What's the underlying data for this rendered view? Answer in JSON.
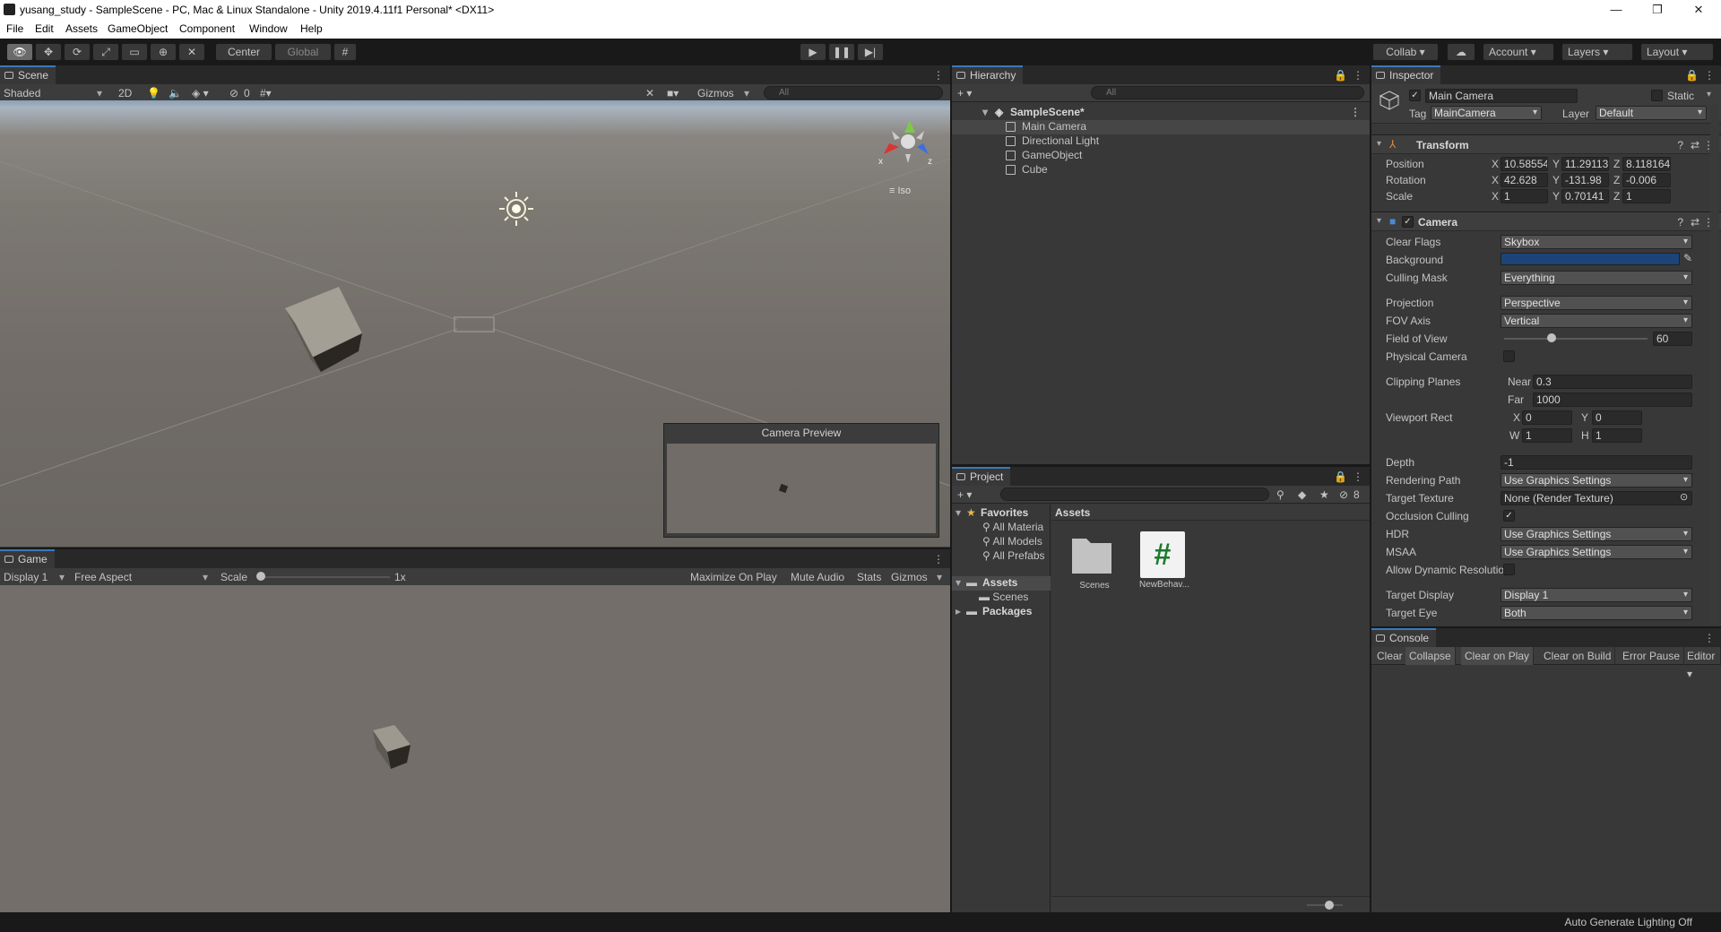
{
  "window": {
    "title": "yusang_study - SampleScene - PC, Mac & Linux Standalone - Unity 2019.4.11f1 Personal* <DX11>",
    "controls": [
      "—",
      "❐",
      "✕"
    ]
  },
  "menu": [
    "File",
    "Edit",
    "Assets",
    "GameObject",
    "Component",
    "Window",
    "Help"
  ],
  "toolbar": {
    "pivot_label": "Center",
    "space_label": "Global",
    "collab_label": "Collab ▾",
    "account_label": "Account",
    "layers_label": "Layers",
    "layout_label": "Layout"
  },
  "scene": {
    "tab_label": "Scene",
    "shading_mode": "Shaded",
    "mode_2d": "2D",
    "hidden_count": "0",
    "gizmos_label": "Gizmos",
    "search_placeholder": "All",
    "projection_label": "≡ Iso",
    "camera_preview_title": "Camera Preview",
    "axis_x": "x",
    "axis_z": "z"
  },
  "game": {
    "tab_label": "Game",
    "display": "Display 1",
    "aspect": "Free Aspect",
    "scale_label": "Scale",
    "scale_value": "1x",
    "scale_level": 0.0,
    "maximize_label": "Maximize On Play",
    "mute_label": "Mute Audio",
    "stats_label": "Stats",
    "gizmos_label": "Gizmos"
  },
  "hierarchy": {
    "tab_label": "Hierarchy",
    "search_placeholder": "All",
    "scene_name": "SampleScene*",
    "items": [
      "Main Camera",
      "Directional Light",
      "GameObject",
      "Cube"
    ]
  },
  "project": {
    "tab_label": "Project",
    "hidden_count": "8",
    "favorites_label": "Favorites",
    "favorites": [
      "All Materia",
      "All Models",
      "All Prefabs"
    ],
    "assets_label": "Assets",
    "asset_folders": [
      "Scenes"
    ],
    "packages_label": "Packages",
    "breadcrumb": "Assets",
    "grid_items": [
      {
        "name": "Scenes",
        "icon": "folder-icon"
      },
      {
        "name": "NewBehav...",
        "icon": "csharp-script-icon"
      }
    ]
  },
  "inspector": {
    "tab_label": "Inspector",
    "object_name": "Main Camera",
    "static_label": "Static",
    "tag_label": "Tag",
    "tag_value": "MainCamera",
    "layer_label": "Layer",
    "layer_value": "Default",
    "transform": {
      "header": "Transform",
      "position_label": "Position",
      "rotation_label": "Rotation",
      "scale_label": "Scale",
      "position": [
        "10.58554",
        "11.29113",
        "8.118164"
      ],
      "rotation": [
        "42.628",
        "-131.98",
        "-0.006"
      ],
      "scale": [
        "1",
        "0.70141",
        "1"
      ]
    },
    "camera": {
      "header": "Camera",
      "clear_flags_label": "Clear Flags",
      "clear_flags": "Skybox",
      "background_label": "Background",
      "background_color": "#1d4478",
      "culling_mask_label": "Culling Mask",
      "culling_mask": "Everything",
      "projection_label": "Projection",
      "projection": "Perspective",
      "fov_axis_label": "FOV Axis",
      "fov_axis": "Vertical",
      "fov_label": "Field of View",
      "fov": "60",
      "fov_level": 0.33,
      "physical_label": "Physical Camera",
      "clipping_label": "Clipping Planes",
      "near_label": "Near",
      "near": "0.3",
      "far_label": "Far",
      "far": "1000",
      "viewport_label": "Viewport Rect",
      "vx": "0",
      "vy": "0",
      "vw": "1",
      "vh": "1",
      "depth_label": "Depth",
      "depth": "-1",
      "rendering_path_label": "Rendering Path",
      "rendering_path": "Use Graphics Settings",
      "target_texture_label": "Target Texture",
      "target_texture": "None (Render Texture)",
      "occlusion_label": "Occlusion Culling",
      "hdr_label": "HDR",
      "hdr": "Use Graphics Settings",
      "msaa_label": "MSAA",
      "msaa": "Use Graphics Settings",
      "dynamic_res_label": "Allow Dynamic Resolutio",
      "target_display_label": "Target Display",
      "target_display": "Display 1",
      "target_eye_label": "Target Eye",
      "target_eye": "Both"
    }
  },
  "console": {
    "tab_label": "Console",
    "buttons": [
      "Clear",
      "Collapse",
      "Clear on Play",
      "Clear on Build",
      "Error Pause",
      "Editor ▾"
    ]
  },
  "status": {
    "lighting": "Auto Generate Lighting Off"
  },
  "colors": {
    "accent": "#3a79bb",
    "editor_bg": "#383838",
    "toolbar_bg": "#191919"
  }
}
